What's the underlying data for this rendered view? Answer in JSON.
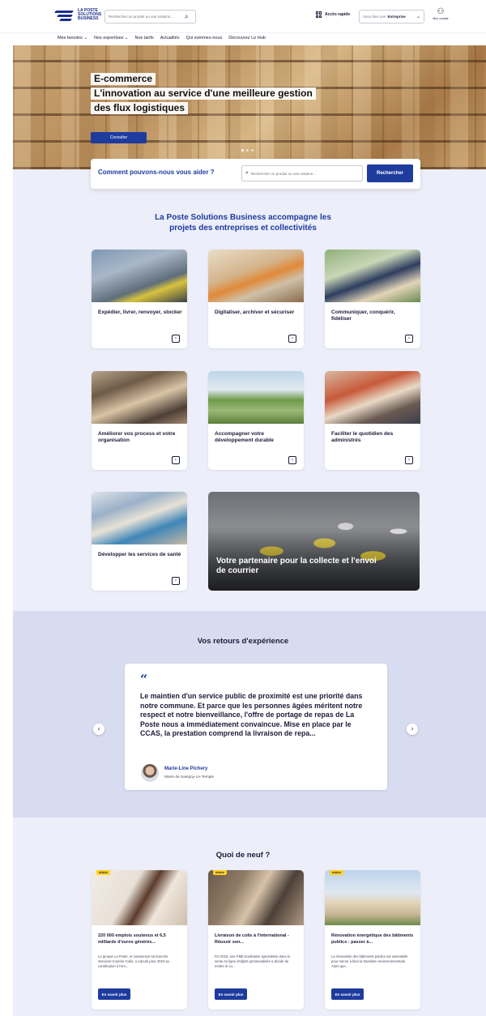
{
  "header": {
    "logo_text": "LA POSTE SOLUTIONS BUSINESS",
    "search_placeholder": "Rechercher un produit ou une solution...",
    "quick_access": "Accès rapide",
    "profile_prefix": "Vous êtes une",
    "profile_value": "Entreprise",
    "account_label": "Mon compte"
  },
  "nav": {
    "items": [
      "Mes besoins ⌄",
      "Nos expertises ⌄",
      "Nos tarifs",
      "Actualités",
      "Qui sommes-nous",
      "Découvrez Le Hub"
    ]
  },
  "hero": {
    "line1": "E-commerce",
    "line2": "L'innovation au service d'une meilleure gestion",
    "line3": "des flux logistiques",
    "cta": "Consulter"
  },
  "help": {
    "question": "Comment pouvons-nous vous aider ?",
    "placeholder": "Rechercher un produit ou une solution...",
    "button": "Rechercher"
  },
  "intro": {
    "line1": "La Poste Solutions Business accompagne les",
    "line2": "projets des entreprises et collectivités"
  },
  "cards": [
    {
      "title": "Expédier, livrer, renvoyer, stocker"
    },
    {
      "title": "Digitaliser, archiver et sécuriser"
    },
    {
      "title": "Communiquer, conquérir, fidéliser"
    },
    {
      "title": "Améliorer vos process et votre organisation"
    },
    {
      "title": "Accompagner votre développement durable"
    },
    {
      "title": "Faciliter le quotidien des administrés"
    },
    {
      "title": "Développer les services de santé"
    }
  ],
  "wide_card": {
    "title": "Votre partenaire pour la collecte et l'envoi de courrier"
  },
  "testimonials": {
    "title": "Vos retours d'expérience",
    "quote_mark": "“",
    "quote": "Le maintien d'un service public de proximité est une priorité dans notre commune. Et parce que les personnes âgées méritent notre respect et notre bienveillance, l'offre de portage de repas de La Poste nous a immédiatement convaincue. Mise en place par le CCAS, la prestation comprend la livraison de repa...",
    "name": "Marie-Line Pichery",
    "role": "Maire de Savigny-Le-Temple",
    "prev": "‹",
    "next": "›"
  },
  "news": {
    "title": "Quoi de neuf ?",
    "items": [
      {
        "badge": "Article",
        "title": "220 000 emplois soutenus et 6,5 milliards d'euros générés...",
        "text": "Le groupe La Poste, et notamment sa branche Services-Courrier-Colis, a calculé pour 2023 sa contribution à l'em...",
        "button": "En savoir plus"
      },
      {
        "badge": "Article",
        "title": "Livraison de colis à l'international - Réussir son...",
        "text": "Fin 2023, une PME bordelaise spécialisée dans la vente en ligne d'objets personnalisés a décidé de mettre le cu...",
        "button": "En savoir plus"
      },
      {
        "badge": "Article",
        "title": "Rénovation énergétique des bâtiments publics : passer à...",
        "text": "La rénovation des bâtiments publics est essentielle pour mener à bien la transition environnementale. Alors que...",
        "button": "En savoir plus"
      }
    ]
  }
}
